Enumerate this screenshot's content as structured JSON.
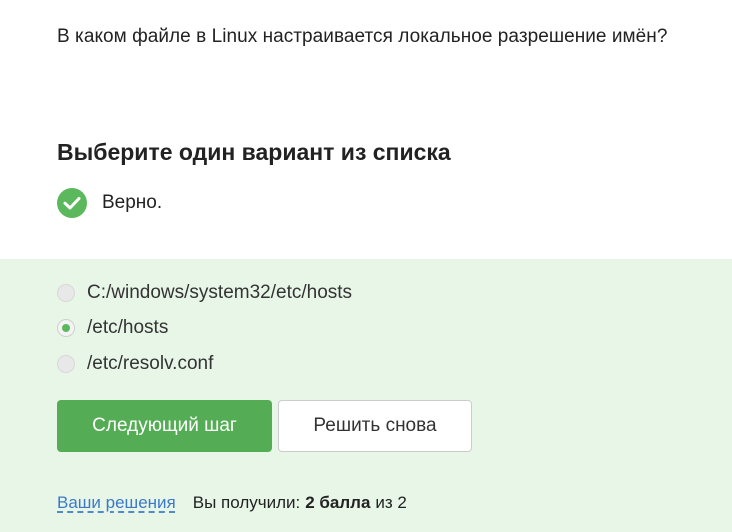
{
  "question": {
    "text": "В каком файле в Linux настраивается локальное разрешение имён?"
  },
  "task": {
    "heading": "Выберите один вариант из списка",
    "result_text": "Верно.",
    "result_status": "correct"
  },
  "options": [
    {
      "label": "C:/windows/system32/etc/hosts",
      "selected": false
    },
    {
      "label": "/etc/hosts",
      "selected": true
    },
    {
      "label": "/etc/resolv.conf",
      "selected": false
    }
  ],
  "buttons": {
    "next_label": "Следующий шаг",
    "retry_label": "Решить снова"
  },
  "footer": {
    "solutions_link": "Ваши решения",
    "score_prefix": "Вы получили:",
    "score_value": "2 балла",
    "score_suffix": "из 2"
  },
  "colors": {
    "accent_green": "#54ad54",
    "panel_background": "#e8f6e8",
    "link": "#3b7ac8"
  }
}
